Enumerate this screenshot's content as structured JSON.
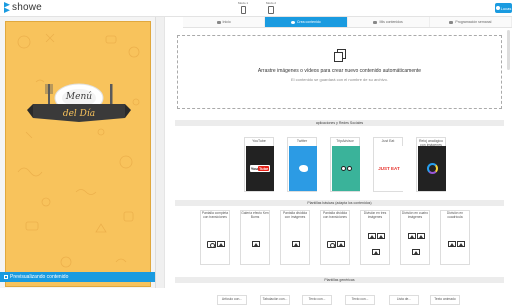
{
  "app": {
    "name": "showe",
    "user_label": "Lucas"
  },
  "toolbar": {
    "device_phone": "Modo 1",
    "device_tablet": "Modo 2"
  },
  "tabs": [
    {
      "label": "Inicio",
      "active": false
    },
    {
      "label": "Crea contenido",
      "active": true
    },
    {
      "label": "Mis contenidos",
      "active": false
    },
    {
      "label": "Programación semanal",
      "active": false
    }
  ],
  "dropzone": {
    "main_text": "Arrastre imágenes o vídeos para crear nuevo contenido automáticamente",
    "sub_text": "El contenido se guardará con el nombre de su archivo."
  },
  "sections": {
    "apps": "aplicaciones y Redes Sociales",
    "templates": "Plantillas básicas (adapta los contenidos)",
    "generic": "Plantillas genéricas"
  },
  "apps": [
    {
      "label": "YouTube",
      "icon": "youtube-icon"
    },
    {
      "label": "Twitter",
      "icon": "twitter-icon"
    },
    {
      "label": "TripAdvisor",
      "icon": "tripadvisor-icon"
    },
    {
      "label": "Just Eat",
      "icon": "just-eat-icon",
      "art_text": "JUST EAT"
    },
    {
      "label": "Reloj analógico con imágenes",
      "icon": "clock-icon"
    }
  ],
  "templates": [
    "Pantalla completa con transiciones",
    "Galería efecto Ken Burns",
    "Pantalla dividida con imágenes",
    "Pantalla dividida con transiciones",
    "División en tres imágenes",
    "División en cuatro imágenes",
    "División en cuadrícula"
  ],
  "generic": [
    "Artículo con...",
    "Tabulación con...",
    "Texto con...",
    "Texto con...",
    "Lista de...",
    "Texto animado"
  ],
  "preview": {
    "label": "Previsualizando contenido",
    "menu_title_line1": "Menú",
    "menu_title_line2": "del Día"
  },
  "colors": {
    "accent": "#1a9be0",
    "preview_bg": "#f8c35c",
    "banner": "#3a3a3a"
  }
}
